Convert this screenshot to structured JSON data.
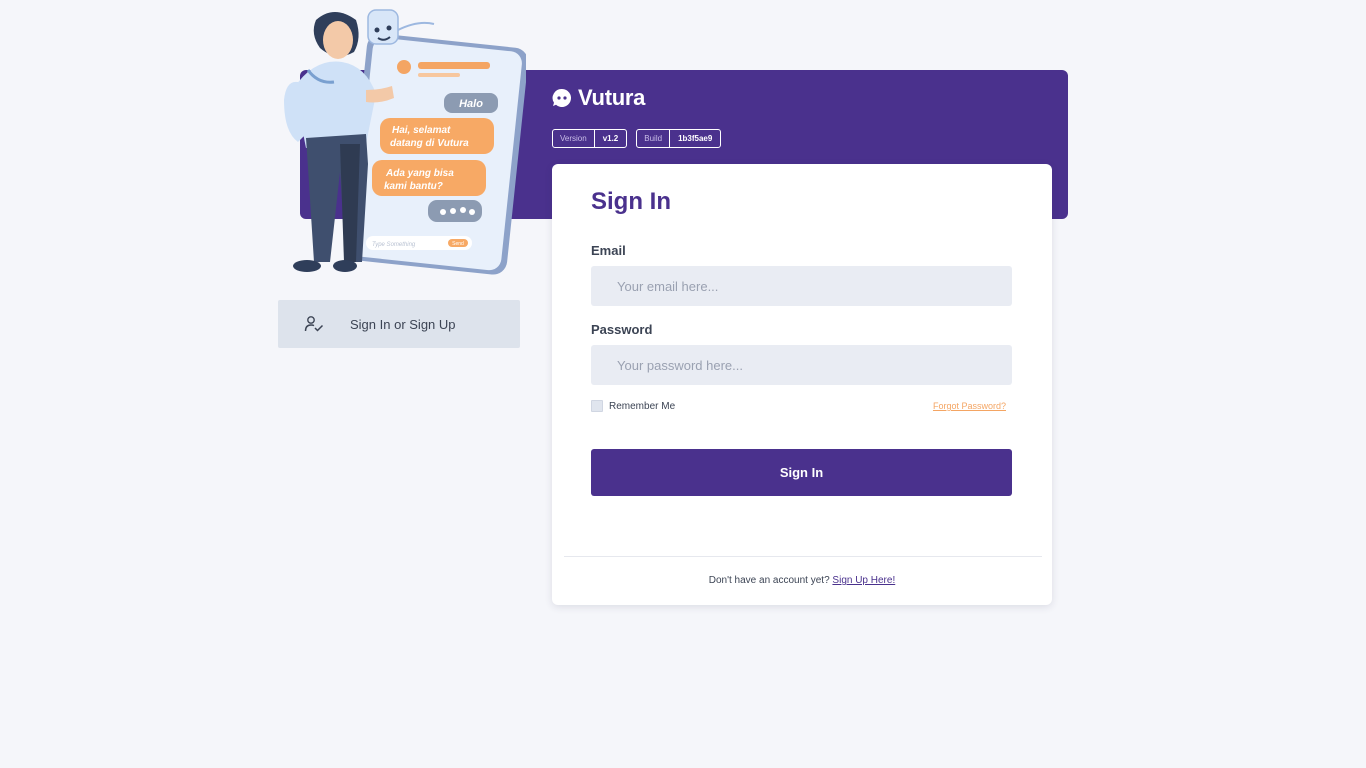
{
  "brand": {
    "name": "Vutura"
  },
  "tags": [
    {
      "key": "Version",
      "value": "v1.2"
    },
    {
      "key": "Build",
      "value": "1b3f5ae9"
    }
  ],
  "illustration": {
    "bubbles": [
      "Halo",
      "Hai, selamat",
      "datang di Vutura",
      "Ada yang bisa",
      "kami bantu?"
    ],
    "input_placeholder": "Type Something",
    "send_label": "Send"
  },
  "side_nav": {
    "label": "Sign In or Sign Up",
    "icon": "user-check-icon"
  },
  "form": {
    "title": "Sign In",
    "email_label": "Email",
    "email_placeholder": "Your email here...",
    "password_label": "Password",
    "password_placeholder": "Your password here...",
    "remember_label": "Remember Me",
    "forgot_label": "Forgot Password?",
    "submit_label": "Sign In"
  },
  "footer": {
    "text": "Don't have an account yet?",
    "link": "Sign Up Here!"
  },
  "colors": {
    "primary": "#4a318d",
    "accent": "#f4a563",
    "background": "#f5f6fa"
  }
}
